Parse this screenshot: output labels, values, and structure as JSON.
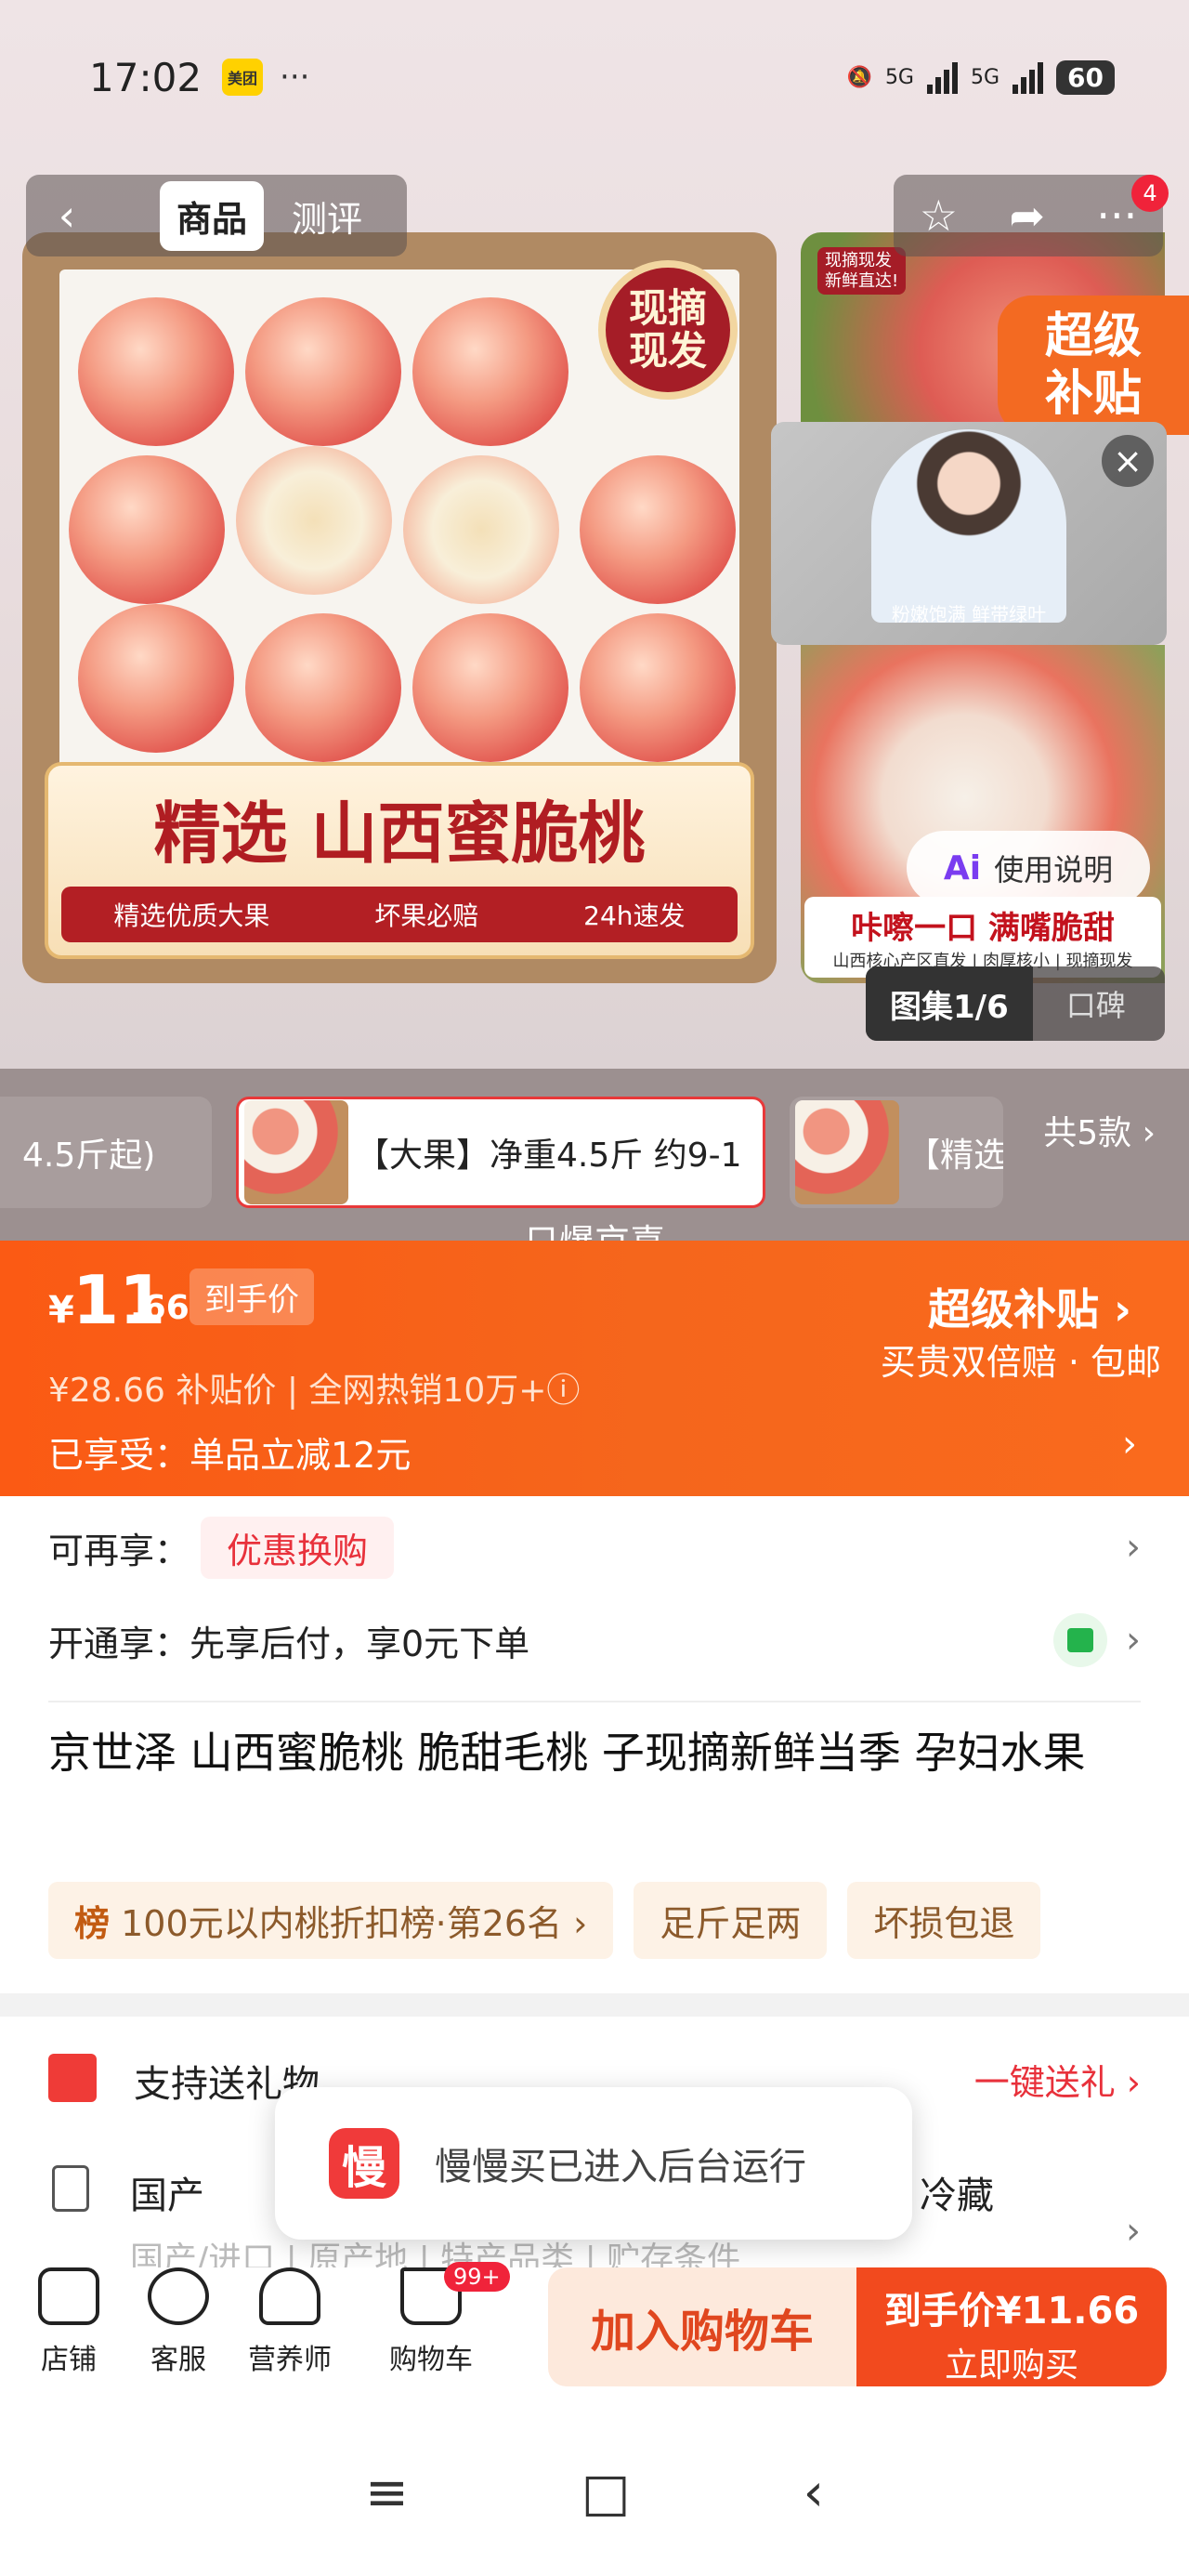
{
  "status_bar": {
    "time": "17:02",
    "app_badge": "美团",
    "more": "···",
    "network_1": "5G",
    "network_2": "5G",
    "battery": "60"
  },
  "top_nav": {
    "back": "‹",
    "tabs": [
      "商品",
      "测评"
    ],
    "cart_badge": "4"
  },
  "hero": {
    "stamp": "现摘\n现发",
    "banner_title": "精选 山西蜜脆桃",
    "banner_features": [
      "精选优质大果",
      "坏果必赔",
      "24h速发"
    ],
    "side_top_tag": "现摘现发\n新鲜直达!",
    "super_subsidy_badge": "超级\n补贴",
    "video_caption": "粉嫩饱满 鲜带绿叶",
    "side_tagline": "咔嚓一口 满嘴脆甜",
    "side_tagline_sub": "山西核心产区直发 | 肉厚核小 | 现摘现发",
    "ai_label": "Ai",
    "ai_text": "使用说明",
    "album_label": "图集1/6",
    "reviews_label": "口碑"
  },
  "sku": {
    "items": [
      "4.5斤起)",
      "【大果】净重4.5斤 约9-1",
      "【精选"
    ],
    "more": "共5款 ›",
    "note": "只爆京喜"
  },
  "price": {
    "currency": "¥",
    "integer": "11",
    "decimal": ".66",
    "tag": "到手价",
    "line2": "¥28.66 补贴价 | 全网热销10万+ⓘ",
    "line3": "已享受：单品立减12元",
    "super_title": "超级补贴 ›",
    "super_sub": "买贵双倍赔 · 包邮"
  },
  "offers": {
    "more_label": "可再享：",
    "coupon": "优惠换购",
    "open_label": "开通享：先享后付，享0元下单"
  },
  "product": {
    "title": "京世泽 山西蜜脆桃 脆甜毛桃 子现摘新鲜当季 孕妇水果",
    "rank_tag_prefix": "榜",
    "rank_tag": "100元以内桃折扣榜·第26名 ›",
    "tag2": "足斤足两",
    "tag3": "坏损包退"
  },
  "attrs": {
    "gift": "支持送礼物",
    "gift_link": "一键送礼 ›",
    "origin": "国产",
    "storage": "冷藏",
    "faded": "国产/进口 | 原产地 | 特产品类 | 贮存条件"
  },
  "toast": {
    "app_icon": "慢",
    "message": "慢慢买已进入后台运行"
  },
  "bottom_bar": {
    "items": [
      "店铺",
      "客服",
      "营养师",
      "购物车"
    ],
    "cart_count": "99+",
    "add_cart": "加入购物车",
    "buy_l1": "到手价¥11.66",
    "buy_l2": "立即购买"
  },
  "system_nav": [
    "≡",
    "□",
    "‹"
  ]
}
